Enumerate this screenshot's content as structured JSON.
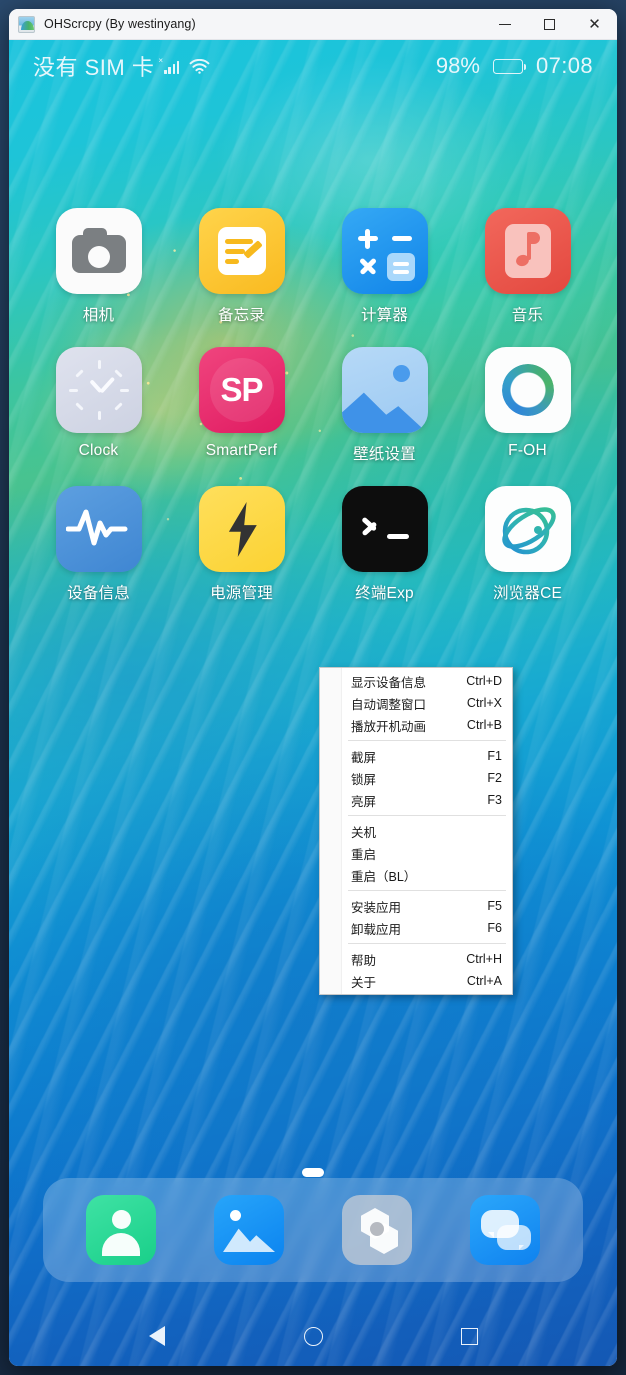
{
  "window": {
    "title": "OHScrcpy (By westinyang)",
    "icon": "app-logo-icon",
    "controls": {
      "minimize": "−",
      "maximize": "□",
      "close": "×"
    }
  },
  "statusbar": {
    "carrier": "没有 SIM 卡",
    "signal_icon": "signal-bars-icon",
    "no_sim_mark": "×",
    "wifi_icon": "wifi-icon",
    "battery_percent": "98%",
    "battery_level": 98,
    "battery_color": "#00e500",
    "clock": "07:08"
  },
  "home": {
    "apps": [
      {
        "label": "相机",
        "icon": "camera-icon"
      },
      {
        "label": "备忘录",
        "icon": "notes-icon"
      },
      {
        "label": "计算器",
        "icon": "calculator-icon"
      },
      {
        "label": "音乐",
        "icon": "music-icon"
      },
      {
        "label": "Clock",
        "icon": "clock-icon"
      },
      {
        "label": "SmartPerf",
        "icon": "smartperf-icon",
        "badge_text": "SP"
      },
      {
        "label": "壁纸设置",
        "icon": "wallpaper-settings-icon"
      },
      {
        "label": "F-OH",
        "icon": "f-oh-icon"
      },
      {
        "label": "设备信息",
        "icon": "device-info-icon"
      },
      {
        "label": "电源管理",
        "icon": "power-manager-icon"
      },
      {
        "label": "终端Exp",
        "icon": "terminal-icon"
      },
      {
        "label": "浏览器CE",
        "icon": "browser-icon"
      }
    ],
    "page_indicator": {
      "pages": 1,
      "current": 1
    },
    "dock": [
      {
        "name": "contacts",
        "icon": "contacts-icon"
      },
      {
        "name": "gallery",
        "icon": "gallery-icon"
      },
      {
        "name": "settings",
        "icon": "settings-icon"
      },
      {
        "name": "messages",
        "icon": "messages-icon"
      }
    ],
    "navbar": [
      {
        "name": "back",
        "icon": "back-triangle-icon"
      },
      {
        "name": "home",
        "icon": "home-circle-icon"
      },
      {
        "name": "recent",
        "icon": "recents-square-icon"
      }
    ]
  },
  "context_menu": {
    "groups": [
      [
        {
          "label": "显示设备信息",
          "accel": "Ctrl+D"
        },
        {
          "label": "自动调整窗口",
          "accel": "Ctrl+X"
        },
        {
          "label": "播放开机动画",
          "accel": "Ctrl+B"
        }
      ],
      [
        {
          "label": "截屏",
          "accel": "F1"
        },
        {
          "label": "锁屏",
          "accel": "F2"
        },
        {
          "label": "亮屏",
          "accel": "F3"
        }
      ],
      [
        {
          "label": "关机",
          "accel": ""
        },
        {
          "label": "重启",
          "accel": ""
        },
        {
          "label": "重启（BL）",
          "accel": ""
        }
      ],
      [
        {
          "label": "安装应用",
          "accel": "F5"
        },
        {
          "label": "卸载应用",
          "accel": "F6"
        }
      ],
      [
        {
          "label": "帮助",
          "accel": "Ctrl+H"
        },
        {
          "label": "关于",
          "accel": "Ctrl+A"
        }
      ]
    ]
  }
}
